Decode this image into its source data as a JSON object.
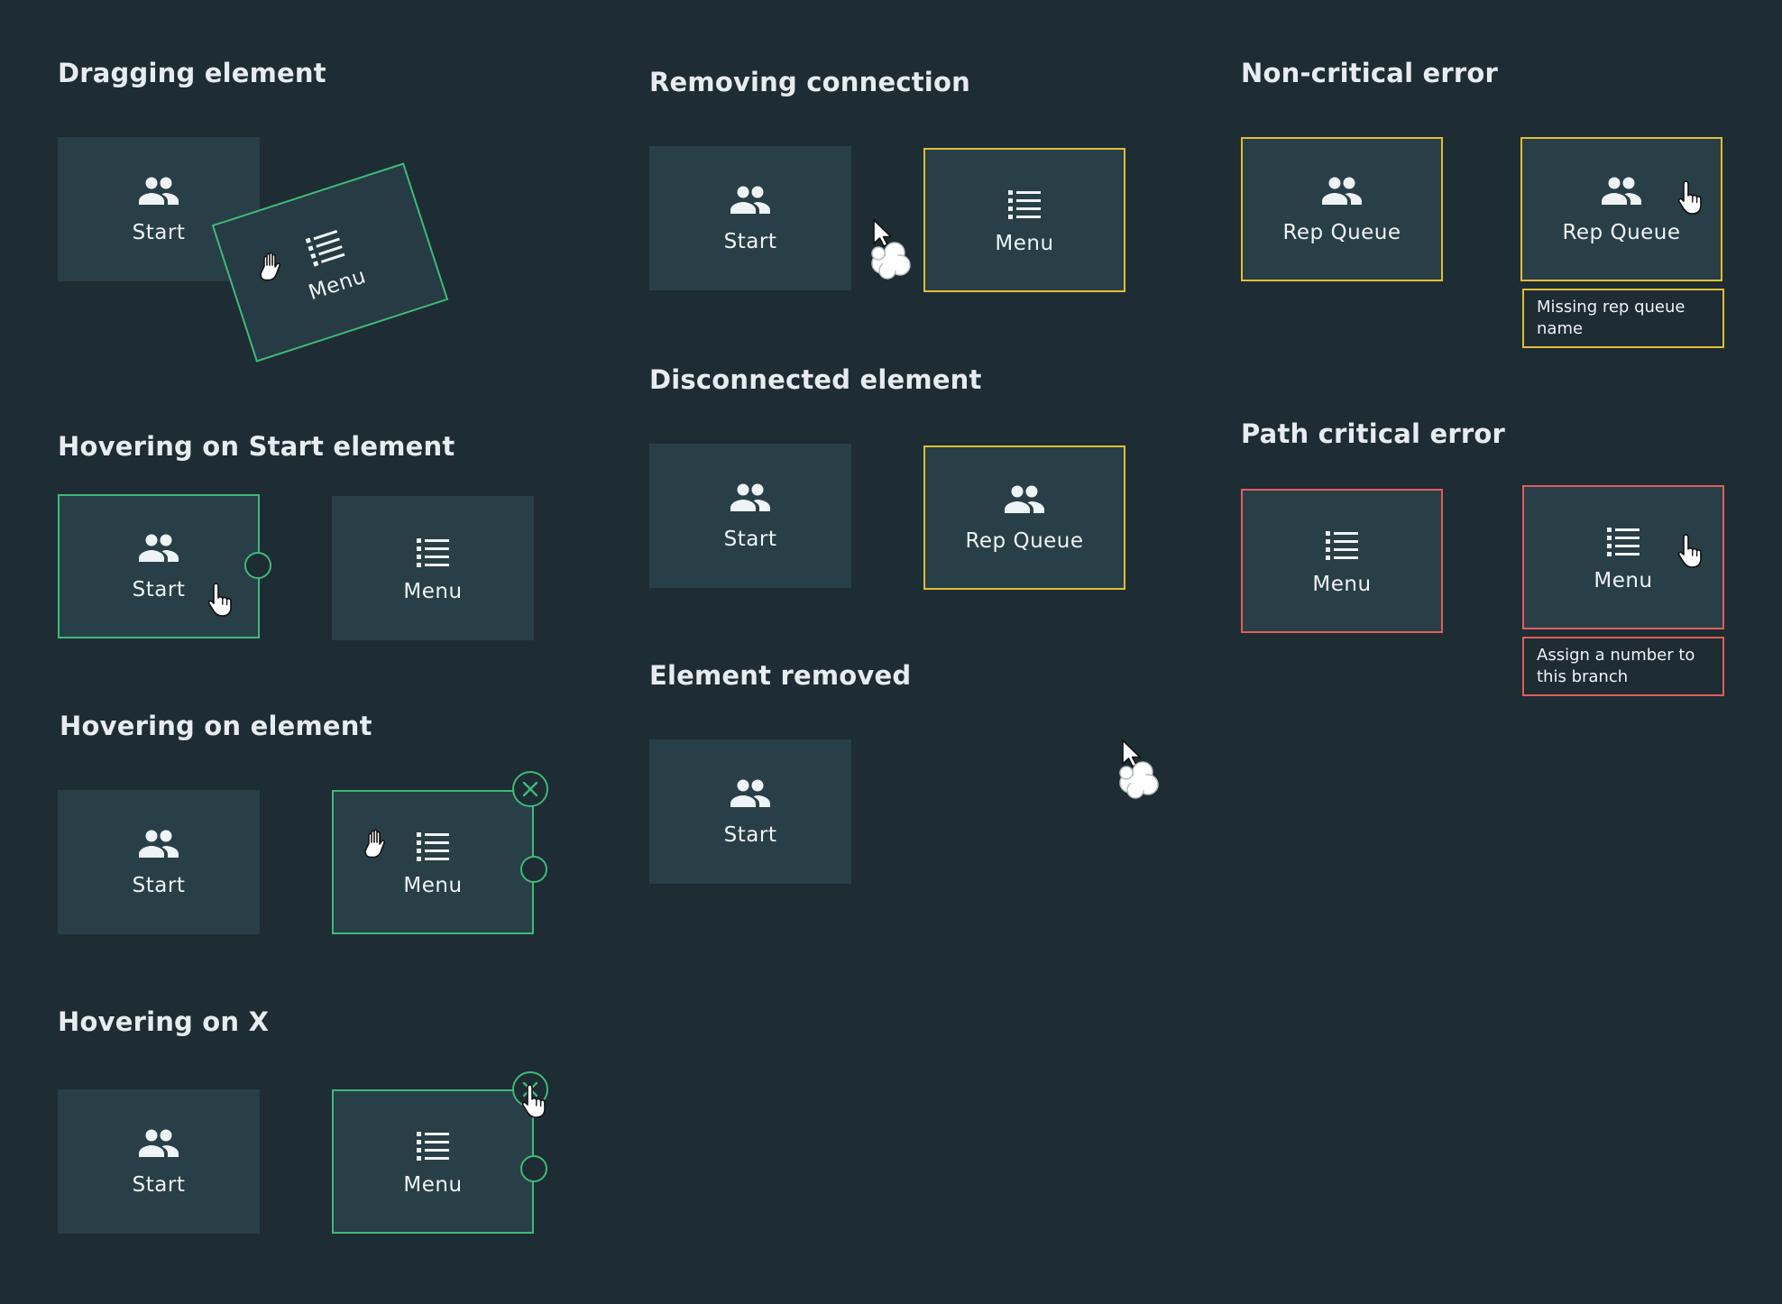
{
  "headings": {
    "dragging": "Dragging element",
    "hover_start": "Hovering on Start element",
    "hover_element": "Hovering on element",
    "hover_x": "Hovering on X",
    "removing_connection": "Removing connection",
    "disconnected": "Disconnected element",
    "element_removed": "Element removed",
    "non_critical": "Non-critical error",
    "path_critical": "Path critical error"
  },
  "labels": {
    "start": "Start",
    "menu": "Menu",
    "rep_queue": "Rep Queue"
  },
  "errors": {
    "missing_rep_queue": "Missing rep queue name",
    "assign_number": "Assign a number to this branch"
  },
  "icons": {
    "people": "people-icon",
    "list": "list-icon",
    "close": "close-icon",
    "hand_grab": "hand-grab-cursor-icon",
    "hand_pointer": "hand-pointer-cursor-icon",
    "arrow": "arrow-cursor-icon",
    "poof": "poof-cloud-icon"
  },
  "colors": {
    "background": "#1e2c33",
    "node": "#293f47",
    "selected": "#3fb978",
    "warning": "#e0bd37",
    "error": "#e05d5d"
  }
}
